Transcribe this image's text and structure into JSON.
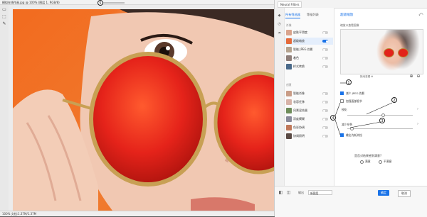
{
  "window": {
    "title": "模拟在线作画.jpg @ 100% (图层 1, RGB/8)"
  },
  "toolbar": {
    "tools": [
      "▭",
      "⬚",
      "✎"
    ]
  },
  "status": {
    "text": "100%   文档:1.37M/1.37M"
  },
  "dialog": {
    "header_tab": "Neural Filters",
    "tabs": [
      "所有筛选器",
      "等候列表"
    ],
    "sections": [
      "肖像",
      "创意"
    ],
    "filters": [
      {
        "label": "皮肤平滑度",
        "on": false
      },
      {
        "label": "超级缩放",
        "on": true
      },
      {
        "label": "智能 JPEG 伪影",
        "on": false
      },
      {
        "label": "着色",
        "on": false
      },
      {
        "label": "样式转换",
        "on": false
      },
      {
        "label": "智能肖像",
        "on": false
      },
      {
        "label": "妆容迁移",
        "on": false
      },
      {
        "label": "风景混合器",
        "on": false
      },
      {
        "label": "深度模糊",
        "on": false
      },
      {
        "label": "色彩协调",
        "on": false
      },
      {
        "label": "协调照明",
        "on": false
      }
    ],
    "panel_title": "超级缩放",
    "panel_subtitle": "缩放以查看图像",
    "preview_caption": "拖动查看 ⊕",
    "checks": [
      {
        "label": "减少 JPEG 伪影",
        "on": true
      },
      {
        "label": "加强面部细节",
        "on": false
      },
      {
        "label": "输出为新文档",
        "on": true
      }
    ],
    "sliders": [
      {
        "label": "锐化",
        "value": 0.55
      },
      {
        "label": "减少杂色",
        "value": 0.06
      }
    ],
    "question": "是否对结果感到满意?",
    "radios": [
      "满意",
      "不满意"
    ],
    "output_select": "新图层",
    "ok_label": "确定",
    "cancel_label": "取消"
  },
  "annotations": [
    "1",
    "2",
    "3",
    "4",
    "5"
  ],
  "colors": {
    "accent": "#1a73e8",
    "background": "#f07a2e",
    "lens": "#e2231a"
  }
}
